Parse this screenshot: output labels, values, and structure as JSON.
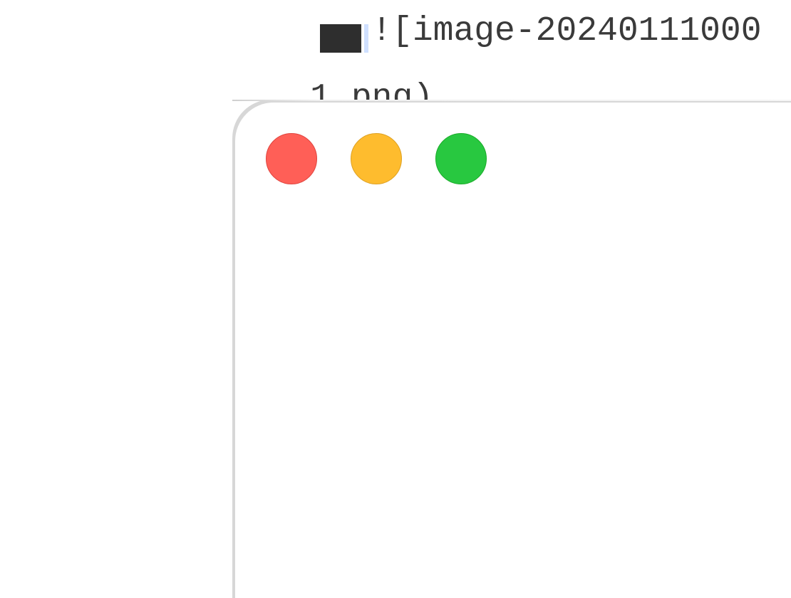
{
  "editor": {
    "line_1_text": "![image-20240111000",
    "line_2_text": "1.png)"
  },
  "window_preview": {
    "traffic_lights": {
      "close_color": "#ff5f57",
      "minimize_color": "#febc2e",
      "zoom_color": "#28c840"
    }
  }
}
